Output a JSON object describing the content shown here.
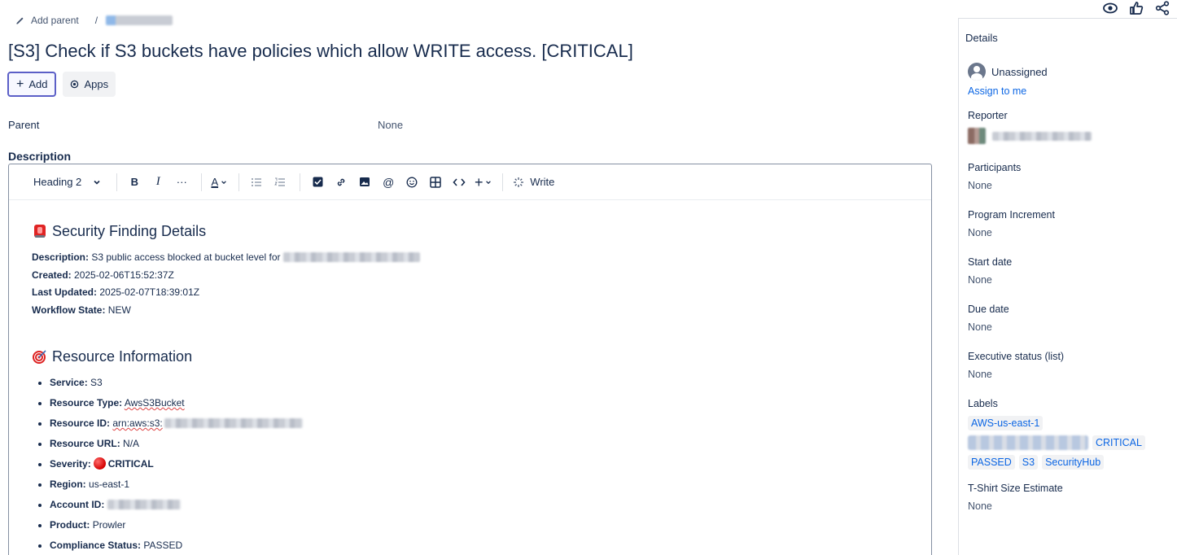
{
  "breadcrumb": {
    "add_parent": "Add parent",
    "separator": "/"
  },
  "issue": {
    "title": "[S3] Check if S3 buckets have policies which allow WRITE access. [CRITICAL]"
  },
  "actions": {
    "add": "Add",
    "apps": "Apps"
  },
  "parent": {
    "label": "Parent",
    "value": "None"
  },
  "description": {
    "label": "Description",
    "toolbar": {
      "style": "Heading 2",
      "write": "Write"
    },
    "section1": {
      "heading": "Security Finding Details",
      "description_label": "Description:",
      "description_value": "S3 public access blocked at bucket level for",
      "created_label": "Created:",
      "created_value": "2025-02-06T15:52:37Z",
      "updated_label": "Last Updated:",
      "updated_value": "2025-02-07T18:39:01Z",
      "workflow_label": "Workflow State:",
      "workflow_value": "NEW"
    },
    "section2": {
      "heading": "Resource Information",
      "items": [
        {
          "label": "Service:",
          "value": "S3"
        },
        {
          "label": "Resource Type:",
          "value": "AwsS3Bucket"
        },
        {
          "label": "Resource ID:",
          "value": "arn:aws:s3:"
        },
        {
          "label": "Resource URL:",
          "value": "N/A"
        },
        {
          "label": "Severity:",
          "value": "CRITICAL"
        },
        {
          "label": "Region:",
          "value": "us-east-1"
        },
        {
          "label": "Account ID:",
          "value": ""
        },
        {
          "label": "Product:",
          "value": "Prowler"
        },
        {
          "label": "Compliance Status:",
          "value": "PASSED"
        }
      ]
    }
  },
  "details": {
    "header": "Details",
    "assignee": {
      "value": "Unassigned",
      "assign_link": "Assign to me"
    },
    "reporter": {
      "label": "Reporter"
    },
    "participants": {
      "label": "Participants",
      "value": "None"
    },
    "program_increment": {
      "label": "Program Increment",
      "value": "None"
    },
    "start_date": {
      "label": "Start date",
      "value": "None"
    },
    "due_date": {
      "label": "Due date",
      "value": "None"
    },
    "executive_status": {
      "label": "Executive status (list)",
      "value": "None"
    },
    "labels": {
      "label": "Labels",
      "items": [
        "AWS-us-east-1",
        "CRITICAL",
        "PASSED",
        "S3",
        "SecurityHub"
      ]
    },
    "tshirt": {
      "label": "T-Shirt Size Estimate",
      "value": "None"
    }
  },
  "colors": {
    "accent": "#0c66e4",
    "text": "#172b4d",
    "severity": "#d40000"
  }
}
